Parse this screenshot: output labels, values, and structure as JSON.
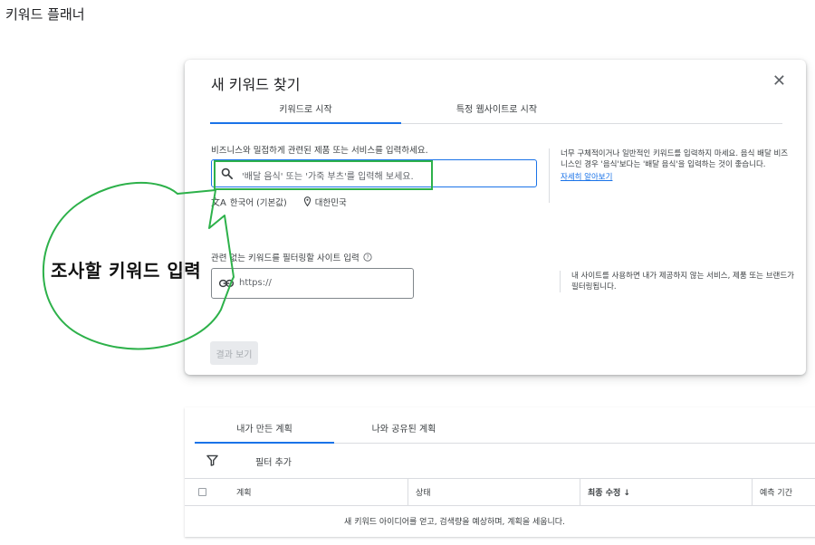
{
  "app": {
    "title": "키워드 플래너"
  },
  "dialog": {
    "title": "새 키워드 찾기",
    "close_icon": "close-icon",
    "tabs": [
      {
        "label": "키워드로 시작",
        "active": true
      },
      {
        "label": "특정 웹사이트로 시작",
        "active": false
      }
    ],
    "keyword_label": "비즈니스와 밀접하게 관련된 제품 또는 서비스를 입력하세요.",
    "keyword_placeholder": "'배달 음식' 또는 '가죽 부츠'를 입력해 보세요.",
    "language": "한국어 (기본값)",
    "location": "대한민국",
    "help_text": "너무 구체적이거나 일반적인 키워드를 입력하지 마세요. 음식 배달 비즈니스인 경우 '음식'보다는 '배달 음식'을 입력하는 것이 좋습니다.",
    "help_link": "자세히 알아보기",
    "site_label": "관련 없는 키워드를 필터링할 사이트 입력",
    "site_placeholder": "https://",
    "site_help": "내 사이트를 사용하면 내가 제공하지 않는 서비스, 제품 또는 브랜드가 필터링됩니다.",
    "results_button": "결과 보기"
  },
  "plans": {
    "tabs": [
      {
        "label": "내가 만든 계획",
        "active": true
      },
      {
        "label": "나와 공유된 계획",
        "active": false
      }
    ],
    "filter_label": "필터 추가",
    "columns": {
      "plan": "계획",
      "status": "상태",
      "last_modified": "최종 수정 ↓",
      "forecast_period": "예측 기간"
    },
    "empty_message": "새 키워드 아이디어를 얻고, 검색량을 예상하며, 계획을 세웁니다."
  },
  "annotation": {
    "label": "조사할 키워드 입력",
    "color": "#2db14a"
  }
}
